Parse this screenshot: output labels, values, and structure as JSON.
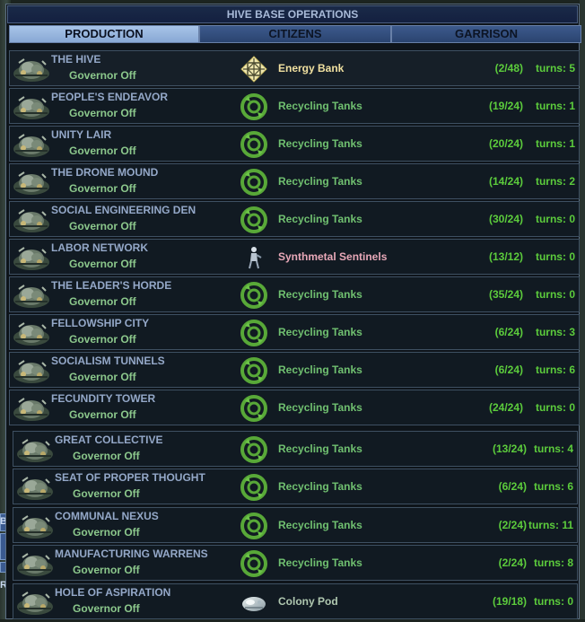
{
  "window_title": "HIVE BASE OPERATIONS",
  "tabs": [
    {
      "label": "PRODUCTION",
      "active": true
    },
    {
      "label": "CITIZENS",
      "active": false
    },
    {
      "label": "GARRISON",
      "active": false
    }
  ],
  "side_fragments": {
    "a": "BA",
    "b": "R"
  },
  "colors": {
    "base_name": "#94a8c8",
    "governor": "#8cc88c",
    "facility": "#70c070",
    "unit": "#e8a8b8",
    "energy_bank": "#f0e0a0",
    "colony_pod": "#b0c8b0",
    "progress": "#5ccc3c"
  },
  "bases": [
    {
      "name": "THE HIVE",
      "governor": "Governor Off",
      "item": "Energy Bank",
      "item_icon": "energy-bank-icon",
      "item_kind": "energy_bank",
      "progress": "(2/48)",
      "turns": "turns:  5"
    },
    {
      "name": "PEOPLE'S ENDEAVOR",
      "governor": "Governor Off",
      "item": "Recycling Tanks",
      "item_icon": "recycling-tanks-icon",
      "item_kind": "facility",
      "progress": "(19/24)",
      "turns": "turns:  1"
    },
    {
      "name": "UNITY LAIR",
      "governor": "Governor Off",
      "item": "Recycling Tanks",
      "item_icon": "recycling-tanks-icon",
      "item_kind": "facility",
      "progress": "(20/24)",
      "turns": "turns:  1"
    },
    {
      "name": "THE DRONE MOUND",
      "governor": "Governor Off",
      "item": "Recycling Tanks",
      "item_icon": "recycling-tanks-icon",
      "item_kind": "facility",
      "progress": "(14/24)",
      "turns": "turns:  2"
    },
    {
      "name": "SOCIAL ENGINEERING DEN",
      "governor": "Governor Off",
      "item": "Recycling Tanks",
      "item_icon": "recycling-tanks-icon",
      "item_kind": "facility",
      "progress": "(30/24)",
      "turns": "turns:  0"
    },
    {
      "name": "LABOR NETWORK",
      "governor": "Governor Off",
      "item": "Synthmetal Sentinels",
      "item_icon": "synthmetal-sentinels-icon",
      "item_kind": "unit",
      "progress": "(13/12)",
      "turns": "turns:  0"
    },
    {
      "name": "THE LEADER'S HORDE",
      "governor": "Governor Off",
      "item": "Recycling Tanks",
      "item_icon": "recycling-tanks-icon",
      "item_kind": "facility",
      "progress": "(35/24)",
      "turns": "turns:  0"
    },
    {
      "name": "FELLOWSHIP CITY",
      "governor": "Governor Off",
      "item": "Recycling Tanks",
      "item_icon": "recycling-tanks-icon",
      "item_kind": "facility",
      "progress": "(6/24)",
      "turns": "turns:  3"
    },
    {
      "name": "SOCIALISM TUNNELS",
      "governor": "Governor Off",
      "item": "Recycling Tanks",
      "item_icon": "recycling-tanks-icon",
      "item_kind": "facility",
      "progress": "(6/24)",
      "turns": "turns:  6"
    },
    {
      "name": "FECUNDITY TOWER",
      "governor": "Governor Off",
      "item": "Recycling Tanks",
      "item_icon": "recycling-tanks-icon",
      "item_kind": "facility",
      "progress": "(24/24)",
      "turns": "turns:  0"
    },
    {
      "name": "GREAT COLLECTIVE",
      "governor": "Governor Off",
      "item": "Recycling Tanks",
      "item_icon": "recycling-tanks-icon",
      "item_kind": "facility",
      "progress": "(13/24)",
      "turns": "turns:  4"
    },
    {
      "name": "SEAT OF PROPER THOUGHT",
      "governor": "Governor Off",
      "item": "Recycling Tanks",
      "item_icon": "recycling-tanks-icon",
      "item_kind": "facility",
      "progress": "(6/24)",
      "turns": "turns:  6"
    },
    {
      "name": "COMMUNAL NEXUS",
      "governor": "Governor Off",
      "item": "Recycling Tanks",
      "item_icon": "recycling-tanks-icon",
      "item_kind": "facility",
      "progress": "(2/24)",
      "turns": "turns:  11"
    },
    {
      "name": "MANUFACTURING WARRENS",
      "governor": "Governor Off",
      "item": "Recycling Tanks",
      "item_icon": "recycling-tanks-icon",
      "item_kind": "facility",
      "progress": "(2/24)",
      "turns": "turns:  8"
    },
    {
      "name": "HOLE OF ASPIRATION",
      "governor": "Governor Off",
      "item": "Colony Pod",
      "item_icon": "colony-pod-icon",
      "item_kind": "colony_pod",
      "progress": "(19/18)",
      "turns": "turns:  0"
    }
  ]
}
